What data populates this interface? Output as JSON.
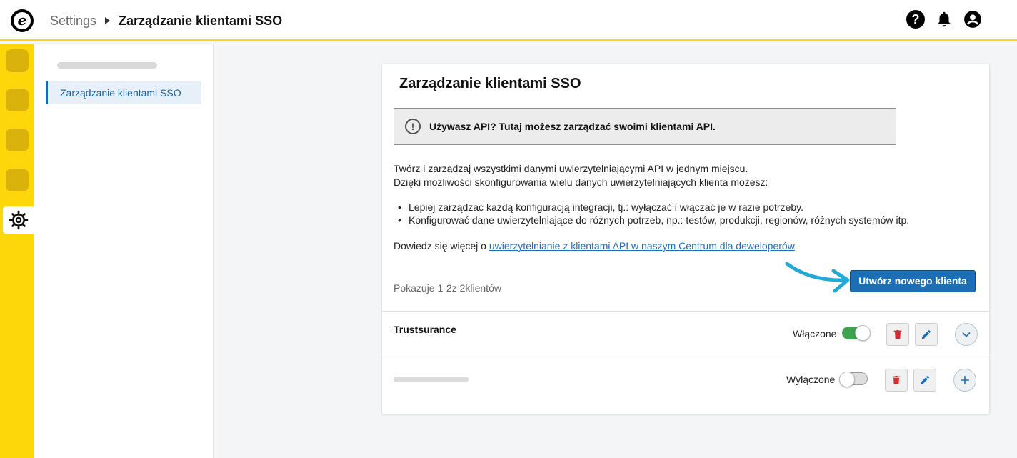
{
  "header": {
    "breadcrumb_root": "Settings",
    "breadcrumb_current": "Zarządzanie klientami SSO",
    "logo_letter": "e",
    "help_glyph": "?",
    "icons": [
      "help-icon",
      "bell-icon",
      "user-icon"
    ]
  },
  "sidebar": {
    "active_item": "Zarządzanie klientami SSO"
  },
  "main": {
    "title": "Zarządzanie klientami SSO",
    "notice": "Używasz API? Tutaj możesz zarządzać swoimi klientami API.",
    "notice_glyph": "!",
    "intro_line1": "Twórz i zarządzaj wszystkimi danymi uwierzytelniającymi API w jednym miejscu.",
    "intro_line2": "Dzięki możliwości skonfigurowania wielu danych uwierzytelniających klienta możesz:",
    "bullets": [
      "Lepiej zarządzać każdą konfiguracją integracji, tj.: wyłączać i włączać je w razie potrzeby.",
      "Konfigurować dane uwierzytelniające do różnych potrzeb, np.: testów, produkcji, regionów, różnych systemów itp."
    ],
    "learn_prefix": "Dowiedz się więcej o ",
    "learn_link": "uwierzytelnianie z klientami API w naszym Centrum dla deweloperów",
    "create_button": "Utwórz nowego klienta",
    "showing": "Pokazuje 1-2z 2klientów"
  },
  "clients": [
    {
      "name": "Trustsurance",
      "status": "Włączone",
      "enabled": true,
      "expand": "chevron-down-icon"
    },
    {
      "name": "",
      "status": "Wyłączone",
      "enabled": false,
      "expand": "plus-icon"
    }
  ],
  "colors": {
    "brand_yellow": "#fdd70a",
    "primary_blue": "#1c6eb5",
    "toggle_on": "#3fa24f",
    "delete_red": "#d32f2f",
    "annotation_arrow": "#22a9d6"
  }
}
